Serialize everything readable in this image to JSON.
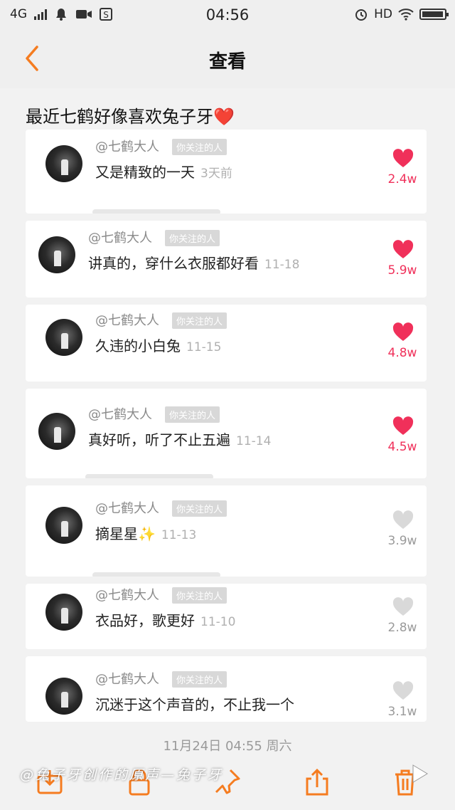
{
  "status_bar": {
    "network": "4G",
    "time": "04:56",
    "hd": "HD"
  },
  "nav": {
    "title": "查看",
    "back_icon": "chevron-left-icon"
  },
  "headline": {
    "text": "最近七鹤好像喜欢兔子牙",
    "emoji": "❤️"
  },
  "colors": {
    "accent": "#f57c20",
    "like_active": "#f0305a",
    "like_inactive": "#d9d9d9"
  },
  "follow_badge": "你关注的人",
  "comments": [
    {
      "user": "@七鹤大人",
      "text": "又是精致的一天",
      "date": "3天前",
      "likes": "2.4w",
      "liked": true
    },
    {
      "user": "@七鹤大人",
      "text": "讲真的，穿什么衣服都好看",
      "date": "11-18",
      "likes": "5.9w",
      "liked": true
    },
    {
      "user": "@七鹤大人",
      "text": "久违的小白兔",
      "date": "11-15",
      "likes": "4.8w",
      "liked": true
    },
    {
      "user": "@七鹤大人",
      "text": "真好听，听了不止五遍",
      "date": "11-14",
      "likes": "4.5w",
      "liked": true
    },
    {
      "user": "@七鹤大人",
      "text": "摘星星✨",
      "date": "11-13",
      "likes": "3.9w",
      "liked": false
    },
    {
      "user": "@七鹤大人",
      "text": "衣品好，歌更好",
      "date": "11-10",
      "likes": "2.8w",
      "liked": false
    },
    {
      "user": "@七鹤大人",
      "text": "沉迷于这个声音的，不止我一个",
      "date": "",
      "likes": "3.1w",
      "liked": false
    }
  ],
  "footer_date": "11月24日 04:55 周六",
  "watermark": "@兔子牙创作的原声—兔子牙",
  "toolbar": [
    "save-icon",
    "lock-icon",
    "pin-icon",
    "share-icon",
    "trash-icon"
  ]
}
